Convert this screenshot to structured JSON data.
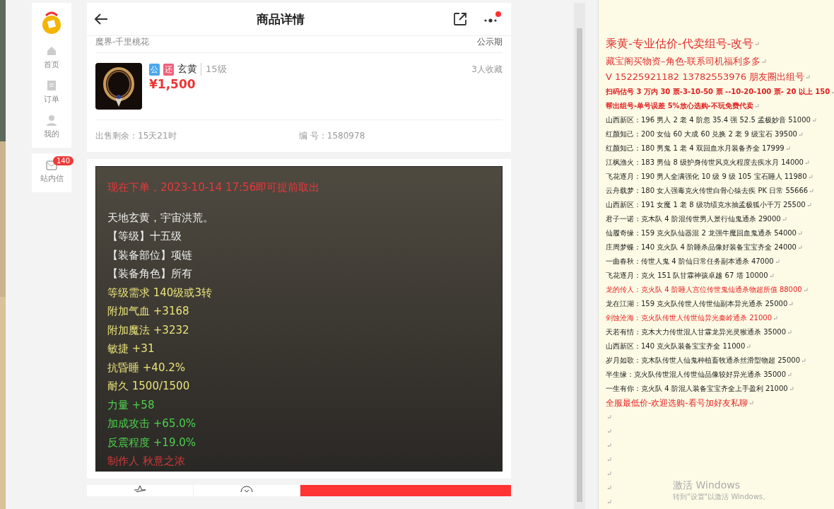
{
  "sidebar": {
    "items": [
      {
        "label": "首页"
      },
      {
        "label": "订单"
      },
      {
        "label": "我的"
      }
    ],
    "messages": {
      "label": "站内信",
      "badge": "140"
    }
  },
  "header": {
    "title": "商品详情",
    "notify_dot": true
  },
  "product": {
    "server": "魔界-千里桃花",
    "status": "公示期",
    "tags": [
      {
        "text": "公",
        "color": "#4aa8ec"
      },
      {
        "text": "还",
        "color": "#f0607a"
      }
    ],
    "name": "玄黄",
    "level": "15级",
    "price": "¥1,500",
    "favorites": "3人收藏",
    "remaining_label": "出售剩余：",
    "remaining": "15天21时",
    "number_label": "编 号：",
    "number": "1580978"
  },
  "description": {
    "lines": [
      {
        "kind": "notice",
        "text": "现在下单，2023-10-14 17:56即可提前取出"
      },
      {
        "kind": "flavor",
        "text": "天地玄黄，宇宙洪荒。"
      },
      {
        "kind": "plain",
        "text": "【等级】十五级"
      },
      {
        "kind": "plain",
        "text": "【装备部位】项链"
      },
      {
        "kind": "plain",
        "text": "【装备角色】所有"
      },
      {
        "kind": "base",
        "text": "等级需求 140级或3转"
      },
      {
        "kind": "base",
        "text": "附加气血 +3168"
      },
      {
        "kind": "base",
        "text": "附加魔法 +3232"
      },
      {
        "kind": "base",
        "text": "敏捷 +31"
      },
      {
        "kind": "base",
        "text": "抗昏睡 +40.2%"
      },
      {
        "kind": "base",
        "text": "耐久 1500/1500"
      },
      {
        "kind": "bonus",
        "text": "力量 +58"
      },
      {
        "kind": "bonus",
        "text": "加成攻击 +65.0%"
      },
      {
        "kind": "bonus",
        "text": "反震程度 +19.0%"
      },
      {
        "kind": "maker",
        "text": "制作人 秋意之浓"
      }
    ]
  },
  "document": {
    "lines": [
      {
        "kind": "title",
        "text": "乘黄-专业估价-代卖组号-改号"
      },
      {
        "kind": "subtitle",
        "text": "藏宝阁买物资–角色-联系司机福利多多"
      },
      {
        "kind": "subtitle",
        "text": "V 15225921182    13782553976 朋友圈出组号"
      },
      {
        "kind": "notice",
        "text": "扫码估号 3 万内 30 票-3-10-50 票  --10-20-100 票- 20 以上 150"
      },
      {
        "kind": "notice",
        "text": "帮出组号-单号误差 5%放心选购-不玩免费代卖"
      },
      {
        "kind": "entry",
        "text": "山西新区：196 男人 2 老 4 阶忽 35.4 强 52.5 孟极妙音 51000"
      },
      {
        "kind": "entry",
        "text": "红颜知己：200 女仙 60 大成 60 兑换 2 老 9 级宝石 39500"
      },
      {
        "kind": "entry",
        "text": "红颜知己：180 男鬼 1 老 4 双回血水月装备齐全 17999"
      },
      {
        "kind": "entry",
        "text": "江枫渔火：183 男仙 8 级护身传世风克火程度去疾水月 14000"
      },
      {
        "kind": "entry",
        "text": "飞花逐月：190 男人全满强化 10 级 9 级 105 宝石睡人 11980"
      },
      {
        "kind": "entry",
        "text": "云舟载梦：180 女人强毒克火传世白骨心猿去疾 PK 日常 55666"
      },
      {
        "kind": "entry",
        "text": "山西新区：191 女魔 1 老 8 级功绩克水抽孟极狐小千万 25500"
      },
      {
        "kind": "entry",
        "text": "君子一诺：克木队 4 阶混传世男人景行仙鬼通杀 29000"
      },
      {
        "kind": "entry",
        "text": "仙履奇缘：159 克火队仙器混 2 龙强牛魔回血鬼通杀 54000"
      },
      {
        "kind": "entry",
        "text": "庄周梦蝶：140 克火队 4 阶睡杀品像好装备宝宝齐全 24000"
      },
      {
        "kind": "entry",
        "text": "一曲春秋：传世人鬼 4 阶仙日常任务副本通杀 47000"
      },
      {
        "kind": "entry",
        "text": "飞花逐月：克火 151 队甘霖神孩卓越 67 塔 10000"
      },
      {
        "kind": "highlight",
        "text": "龙的传人：克火队 4 阶睡人宫位传世鬼仙通杀物超所值 88000"
      },
      {
        "kind": "entry",
        "text": "龙在江湖：159 克火队传世人传世仙副本异光通杀 25000"
      },
      {
        "kind": "highlight",
        "text": "剑蚀沧海：克火队传世人传世仙异光秦岭通杀 21000"
      },
      {
        "kind": "entry",
        "text": "天若有情：克木大力传世混人甘霖龙异光灵猴通杀 35000"
      },
      {
        "kind": "entry",
        "text": "山西新区：140 克火队装备宝宝齐全 11000"
      },
      {
        "kind": "entry",
        "text": "岁月如歌：克木队传世人仙鬼种植畜牧通杀丝滑型物超 25000"
      },
      {
        "kind": "entry",
        "text": "半生缘：克火队传世混人传世仙品像较好异光通杀 35000"
      },
      {
        "kind": "entry",
        "text": "一生有你：克火队 4 阶混人装备宝宝齐全上手盈利 21000"
      },
      {
        "kind": "closing",
        "text": "全服最低价-欢迎选购-看号加好友私聊"
      },
      {
        "kind": "blank"
      },
      {
        "kind": "blank"
      },
      {
        "kind": "blank"
      },
      {
        "kind": "blank"
      },
      {
        "kind": "blank"
      },
      {
        "kind": "blank"
      },
      {
        "kind": "blank"
      }
    ]
  },
  "activation": {
    "title": "激活 Windows",
    "hint": "转到\"设置\"以激活 Windows。"
  }
}
